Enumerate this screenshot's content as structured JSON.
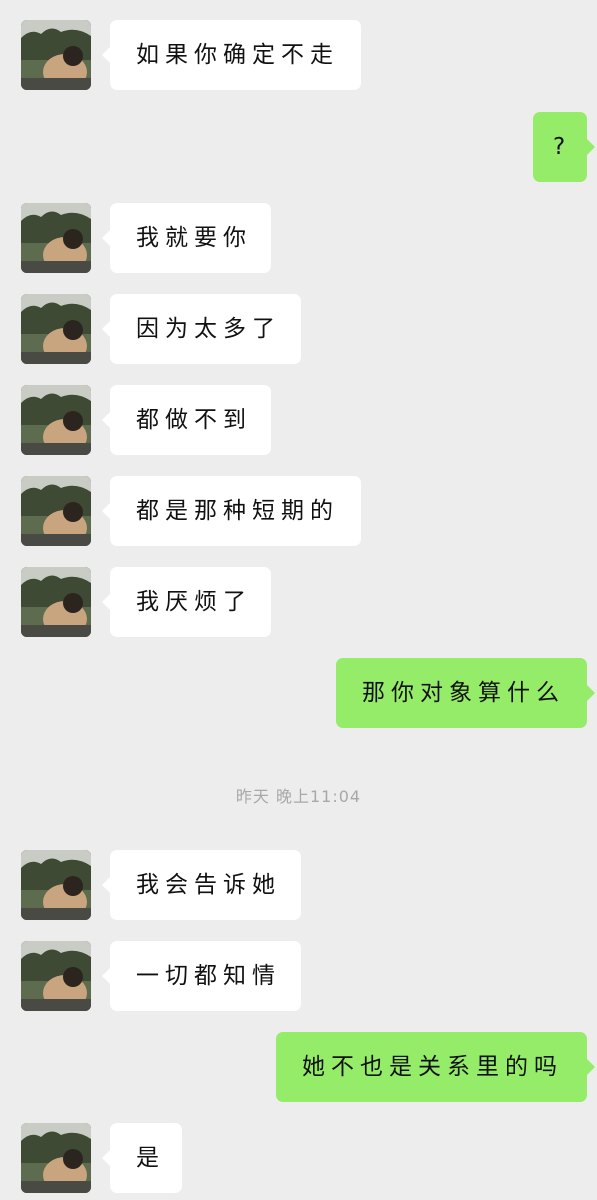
{
  "timestamp": "昨天 晚上11:04",
  "messages": [
    {
      "side": "in",
      "text": "如果你确定不走"
    },
    {
      "side": "out",
      "text": "?"
    },
    {
      "side": "in",
      "text": "我就要你"
    },
    {
      "side": "in",
      "text": "因为太多了"
    },
    {
      "side": "in",
      "text": "都做不到"
    },
    {
      "side": "in",
      "text": "都是那种短期的"
    },
    {
      "side": "in",
      "text": "我厌烦了"
    },
    {
      "side": "out",
      "text": "那你对象算什么"
    },
    {
      "side": "in",
      "text": "我会告诉她"
    },
    {
      "side": "in",
      "text": "一切都知情"
    },
    {
      "side": "out",
      "text": "她不也是关系里的吗"
    },
    {
      "side": "in",
      "text": "是"
    }
  ]
}
